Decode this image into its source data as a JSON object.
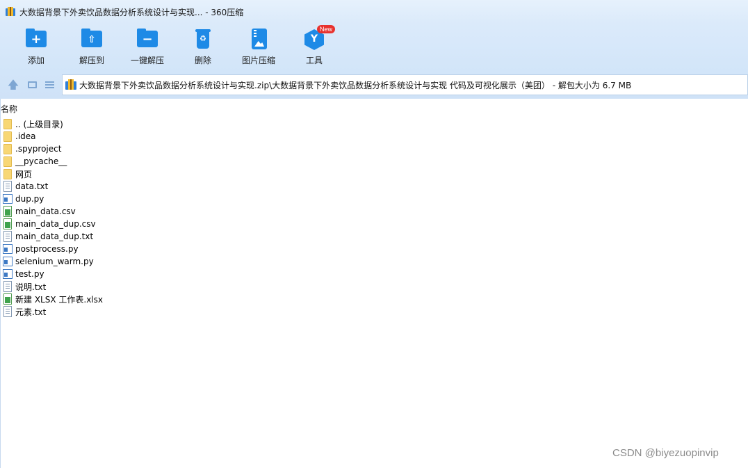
{
  "window": {
    "title": "大数据背景下外卖饮品数据分析系统设计与实现... - 360压缩"
  },
  "toolbar": {
    "add_label": "添加",
    "extract_to_label": "解压到",
    "one_click_extract_label": "一键解压",
    "delete_label": "删除",
    "image_compress_label": "图片压缩",
    "tools_label": "工具",
    "tools_badge": "New"
  },
  "address_bar": {
    "path": "大数据背景下外卖饮品数据分析系统设计与实现.zip\\大数据背景下外卖饮品数据分析系统设计与实现 代码及可视化展示（美团） - 解包大小为 6.7 MB"
  },
  "file_list": {
    "column_name": "名称",
    "items": [
      {
        "name": ".. (上级目录)",
        "type": "folder"
      },
      {
        "name": ".idea",
        "type": "folder"
      },
      {
        "name": ".spyproject",
        "type": "folder"
      },
      {
        "name": "__pycache__",
        "type": "folder"
      },
      {
        "name": "网页",
        "type": "folder"
      },
      {
        "name": "data.txt",
        "type": "text"
      },
      {
        "name": "dup.py",
        "type": "python"
      },
      {
        "name": "main_data.csv",
        "type": "spreadsheet"
      },
      {
        "name": "main_data_dup.csv",
        "type": "spreadsheet"
      },
      {
        "name": "main_data_dup.txt",
        "type": "text"
      },
      {
        "name": "postprocess.py",
        "type": "python"
      },
      {
        "name": "selenium_warm.py",
        "type": "python"
      },
      {
        "name": "test.py",
        "type": "python"
      },
      {
        "name": "说明.txt",
        "type": "text"
      },
      {
        "name": "新建 XLSX 工作表.xlsx",
        "type": "spreadsheet"
      },
      {
        "name": "元素.txt",
        "type": "text"
      }
    ]
  },
  "watermark": "CSDN @biyezuopinvip",
  "colors": {
    "accent": "#1e8ae6",
    "badge": "#e8322e",
    "toolbar_bg": "#d2e5f9"
  }
}
